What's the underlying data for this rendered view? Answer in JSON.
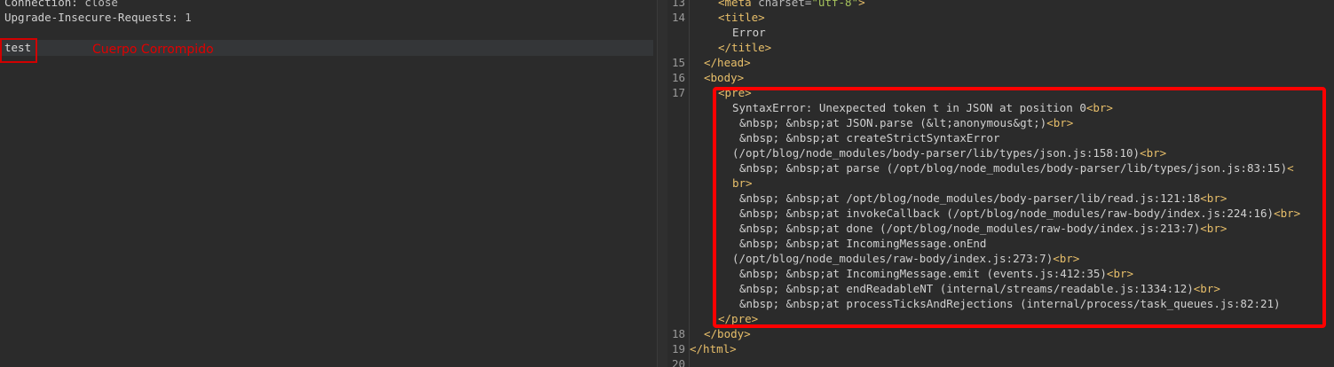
{
  "request": {
    "headers": [
      {
        "name": "Connection:",
        "value": " close"
      },
      {
        "name": "Upgrade-Insecure-Requests:",
        "value": " 1"
      }
    ],
    "body_text": "test",
    "annotation": "Cuerpo Corrompido"
  },
  "response": {
    "lines": [
      {
        "n": "13",
        "html": "meta"
      },
      {
        "n": "14",
        "html": "title"
      },
      {
        "n": "",
        "text": "Error"
      },
      {
        "n": "",
        "html": "/title"
      },
      {
        "n": "15",
        "html": "/head"
      },
      {
        "n": "16",
        "html": "body"
      },
      {
        "n": "17",
        "html": "pre"
      }
    ],
    "meta_attr": "charset=",
    "meta_val": "\"utf-8\"",
    "pre_lines": [
      "SyntaxError: Unexpected token t in JSON at position 0",
      "&nbsp; &nbsp;at JSON.parse (&lt;anonymous&gt;)",
      "&nbsp; &nbsp;at createStrictSyntaxError",
      "(/opt/blog/node_modules/body-parser/lib/types/json.js:158:10)",
      "&nbsp; &nbsp;at parse (/opt/blog/node_modules/body-parser/lib/types/json.js:83:15)",
      "&nbsp; &nbsp;at /opt/blog/node_modules/body-parser/lib/read.js:121:18",
      "&nbsp; &nbsp;at invokeCallback (/opt/blog/node_modules/raw-body/index.js:224:16)",
      "&nbsp; &nbsp;at done (/opt/blog/node_modules/raw-body/index.js:213:7)",
      "&nbsp; &nbsp;at IncomingMessage.onEnd",
      "(/opt/blog/node_modules/raw-body/index.js:273:7)",
      "&nbsp; &nbsp;at IncomingMessage.emit (events.js:412:35)",
      "&nbsp; &nbsp;at endReadableNT (internal/streams/readable.js:1334:12)",
      "&nbsp; &nbsp;at processTicksAndRejections (internal/process/task_queues.js:82:21)"
    ],
    "br": "<br>",
    "br_start": "<",
    "br_wrap": "br>",
    "close_pre": "</pre>",
    "close_body": "</body>",
    "close_html": "</html>",
    "line_numbers_tail": [
      "18",
      "19",
      "20"
    ],
    "tag_meta": "<meta",
    "tag_meta_end": ">",
    "tag_title": "<title>",
    "tag_title_close": "</title>",
    "tag_head_close": "</head>",
    "tag_body": "<body>",
    "tag_pre": "<pre>",
    "title_text": "Error"
  }
}
